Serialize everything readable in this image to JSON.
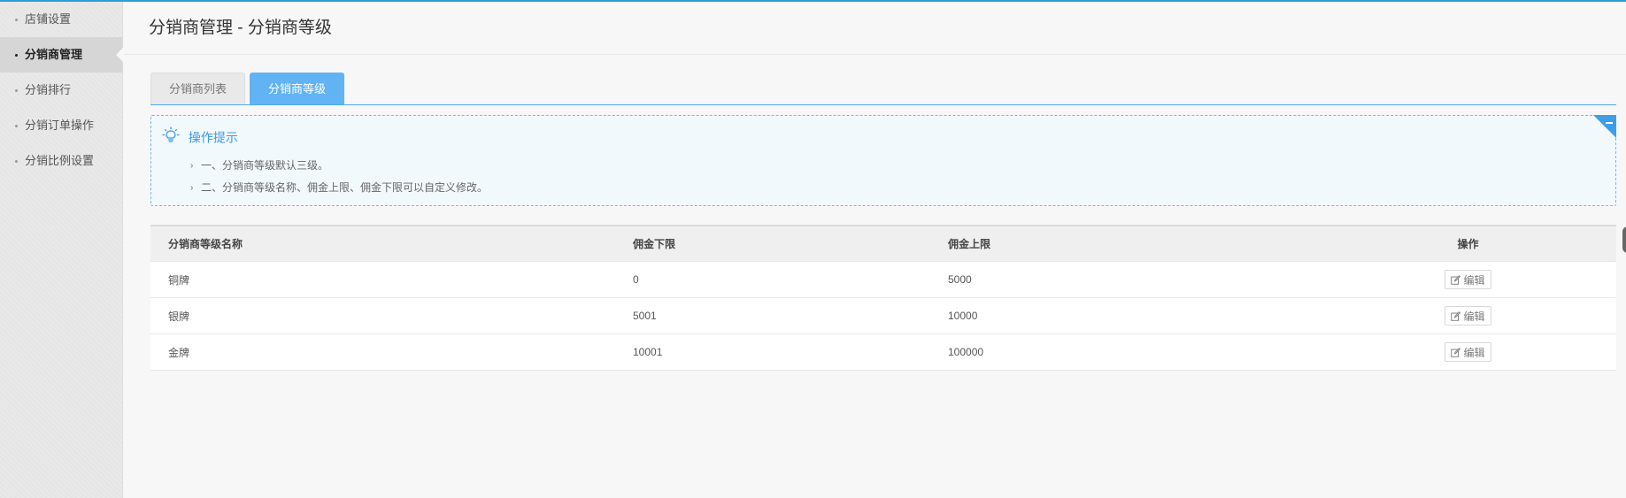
{
  "sidebar": {
    "items": [
      {
        "label": "店铺设置",
        "active": false
      },
      {
        "label": "分销商管理",
        "active": true
      },
      {
        "label": "分销排行",
        "active": false
      },
      {
        "label": "分销订单操作",
        "active": false
      },
      {
        "label": "分销比例设置",
        "active": false
      }
    ]
  },
  "header": {
    "title": "分销商管理 - 分销商等级"
  },
  "tabs": [
    {
      "label": "分销商列表",
      "active": false
    },
    {
      "label": "分销商等级",
      "active": true
    }
  ],
  "tips": {
    "title": "操作提示",
    "icon": "lightbulb-icon",
    "items": [
      "一、分销商等级默认三级。",
      "二、分销商等级名称、佣金上限、佣金下限可以自定义修改。"
    ]
  },
  "table": {
    "columns": [
      "分销商等级名称",
      "佣金下限",
      "佣金上限",
      "操作"
    ],
    "rows": [
      {
        "name": "铜牌",
        "min": "0",
        "max": "5000",
        "action": "编辑"
      },
      {
        "name": "银牌",
        "min": "5001",
        "max": "10000",
        "action": "编辑"
      },
      {
        "name": "金牌",
        "min": "10001",
        "max": "100000",
        "action": "编辑"
      }
    ]
  },
  "colors": {
    "accent": "#62b3f4",
    "tips_border": "#6fbbe8",
    "tips_title": "#3a9be3"
  }
}
